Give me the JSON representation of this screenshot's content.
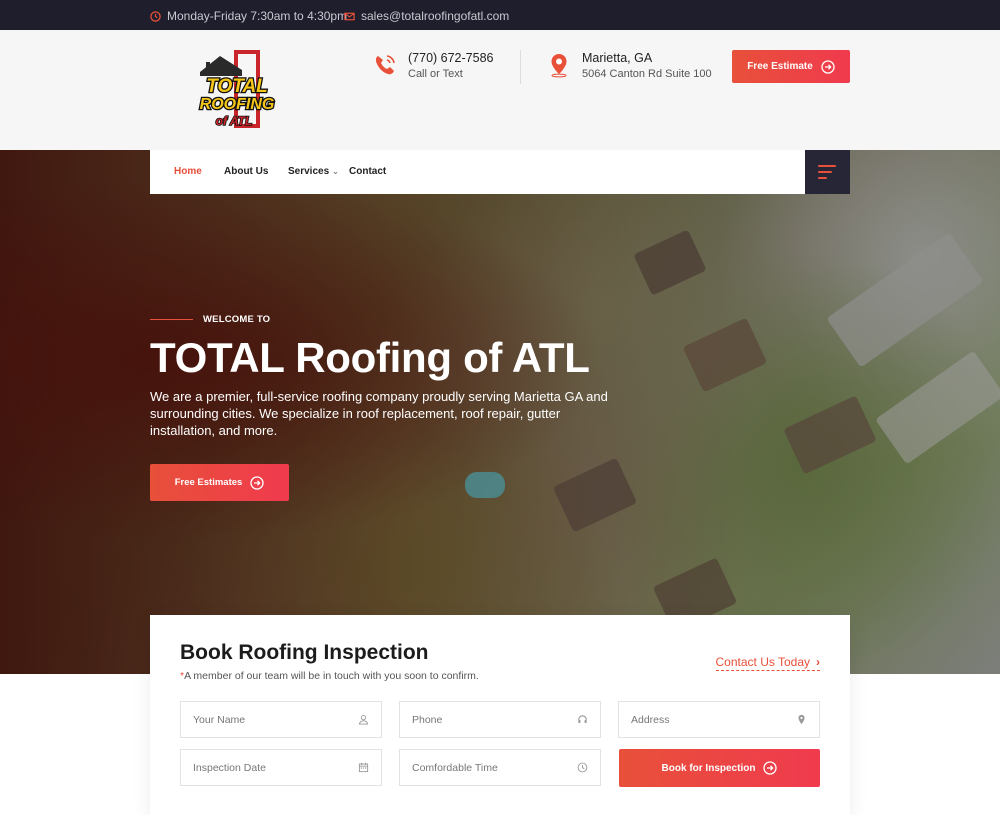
{
  "topbar": {
    "hours": "Monday-Friday 7:30am to 4:30pm",
    "email": "sales@totalroofingofatl.com",
    "icons": [
      "clock-icon",
      "mail-icon"
    ]
  },
  "header": {
    "logo": {
      "line1": "TOTAL",
      "line2": "ROOFING",
      "line3": "of ATL"
    },
    "phone": {
      "number": "(770) 672-7586",
      "sub": "Call or Text",
      "icon": "phone-icon"
    },
    "location": {
      "city": "Marietta, GA",
      "address": "5064 Canton Rd Suite 100",
      "icon": "map-pin-icon"
    },
    "cta_label": "Free Estimate"
  },
  "nav": {
    "items": [
      {
        "label": "Home",
        "active": true
      },
      {
        "label": "About Us"
      },
      {
        "label": "Services"
      },
      {
        "label": "Contact"
      }
    ]
  },
  "hero": {
    "welcome": "WELCOME TO",
    "title": "TOTAL Roofing of ATL",
    "description": "We are a premier, full-service roofing company proudly serving Marietta GA and surrounding cities. We specialize in roof replacement, roof repair, gutter installation, and more.",
    "cta_label": "Free Estimates"
  },
  "booking": {
    "title": "Book Roofing Inspection",
    "note_star": "*",
    "note": "A member of our team will be in touch with you soon to confirm.",
    "contact_link": "Contact Us Today",
    "fields": {
      "name": "Your Name",
      "phone": "Phone",
      "address": "Address",
      "date": "Inspection Date",
      "time": "Comfordable Time"
    },
    "submit_label": "Book for Inspection"
  },
  "colors": {
    "accent": "#e8503a",
    "dark": "#1e1e2c",
    "nav_menu": "#262636"
  }
}
